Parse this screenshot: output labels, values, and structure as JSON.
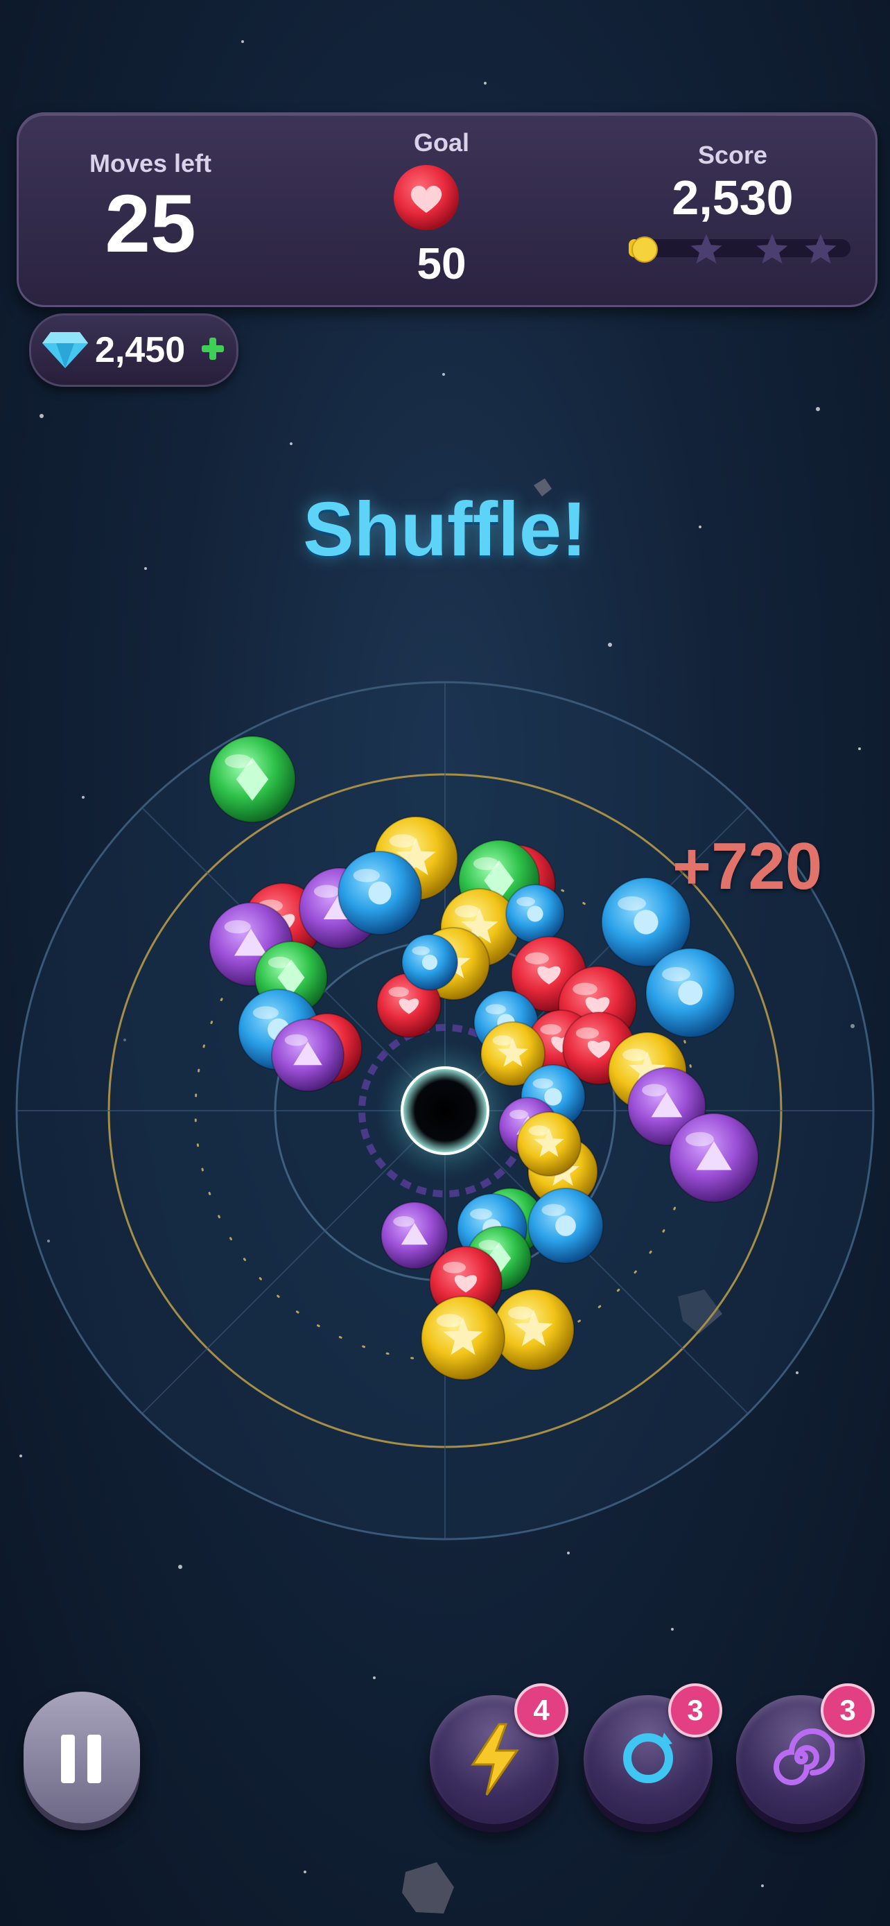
{
  "hud": {
    "moves_label": "Moves left",
    "moves_value": "25",
    "goal_label": "Goal",
    "goal_value": "50",
    "goal_icon": "heart-icon",
    "score_label": "Score",
    "score_value": "2,530",
    "star_progress": 0.05,
    "stars_total": 3
  },
  "currency": {
    "gems": "2,450",
    "icon": "diamond-icon",
    "add_icon": "plus-icon"
  },
  "banner": {
    "text": "Shuffle!"
  },
  "score_popup": {
    "text": "+720"
  },
  "powerups": [
    {
      "name": "lightning",
      "icon": "lightning-icon",
      "count": "4"
    },
    {
      "name": "refresh",
      "icon": "refresh-ring-icon",
      "count": "3"
    },
    {
      "name": "vortex",
      "icon": "vortex-icon",
      "count": "3"
    }
  ],
  "colors": {
    "red": "#e8293c",
    "blue": "#2aa0e8",
    "yellow": "#f2c418",
    "purple": "#9b4fd6",
    "green": "#2fc24a",
    "accent": "#5dd3f7",
    "badge": "#e33f83"
  }
}
